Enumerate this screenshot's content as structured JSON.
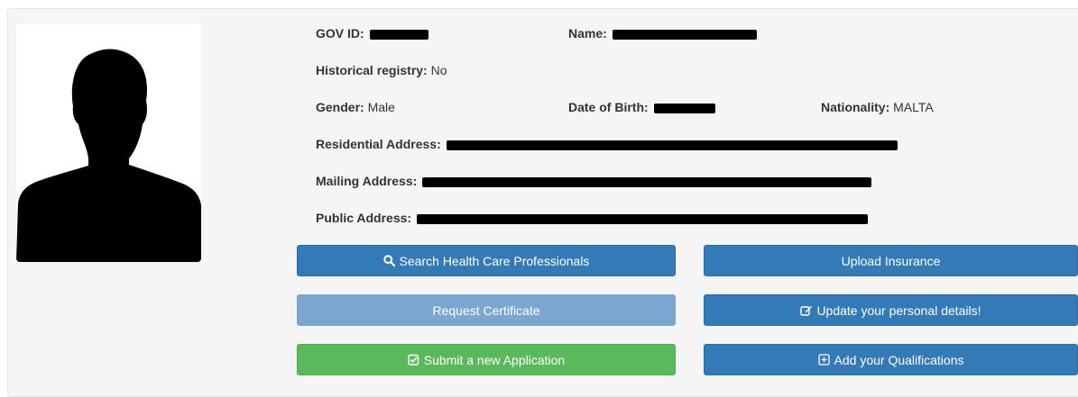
{
  "profile": {
    "gov_id_label": "GOV ID:",
    "name_label": "Name:",
    "historical_registry_label": "Historical registry:",
    "historical_registry_value": "No",
    "gender_label": "Gender:",
    "gender_value": "Male",
    "dob_label": "Date of Birth:",
    "nationality_label": "Nationality:",
    "nationality_value": "MALTA",
    "residential_address_label": "Residential Address:",
    "mailing_address_label": "Mailing Address:",
    "public_address_label": "Public Address:"
  },
  "actions": {
    "search_hcp": "Search Health Care Professionals",
    "upload_insurance": "Upload Insurance",
    "request_certificate": "Request Certificate",
    "update_details": "Update your personal details!",
    "submit_application": "Submit a new Application",
    "add_qualifications": "Add your Qualifications"
  },
  "icons": {
    "search_hcp": "search-icon",
    "update_details": "edit-icon",
    "submit_application": "check-square-icon",
    "add_qualifications": "plus-square-icon"
  },
  "colors": {
    "primary": "#337ab7",
    "primary_disabled": "#7ca6d0",
    "success": "#5cb85c",
    "panel_bg": "#f5f5f5"
  }
}
